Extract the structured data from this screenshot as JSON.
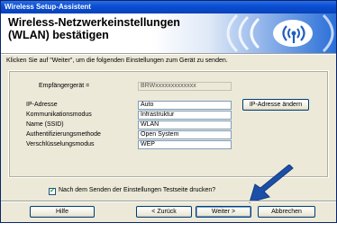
{
  "window": {
    "title": "Wireless Setup-Assistent"
  },
  "header": {
    "title": "Wireless-Netzwerkeinstellungen (WLAN) bestätigen"
  },
  "instruction": "Klicken Sie auf \"Weiter\", um die folgenden Einstellungen zum Gerät zu senden.",
  "settings": {
    "receiver": {
      "label": "Empfängergerät =",
      "value": "BRWxxxxxxxxxxxxx"
    },
    "ip": {
      "label": "IP-Adresse",
      "value": "Auto"
    },
    "comm_mode": {
      "label": "Kommunikationsmodus",
      "value": "Infrastruktur"
    },
    "ssid": {
      "label": "Name (SSID)",
      "value": "WLAN"
    },
    "auth": {
      "label": "Authentifizierungsmethode",
      "value": "Open System"
    },
    "encryption": {
      "label": "Verschlüsselungsmodus",
      "value": "WEP"
    }
  },
  "change_ip_button": "IP-Adresse ändern",
  "print_checkbox": {
    "label": "Nach dem Senden der Einstellungen Testseite drucken?",
    "checked": true
  },
  "buttons": {
    "help": "Hilfe",
    "back": "< Zurück",
    "next": "Weiter >",
    "cancel": "Abbrechen"
  },
  "colors": {
    "titlebar": "#0a4fd6",
    "accent": "#1f5fbf",
    "arrow": "#1d4fa8"
  },
  "icons": [
    "wireless-logo-icon",
    "pointer-arrow-icon",
    "checkmark-icon"
  ]
}
